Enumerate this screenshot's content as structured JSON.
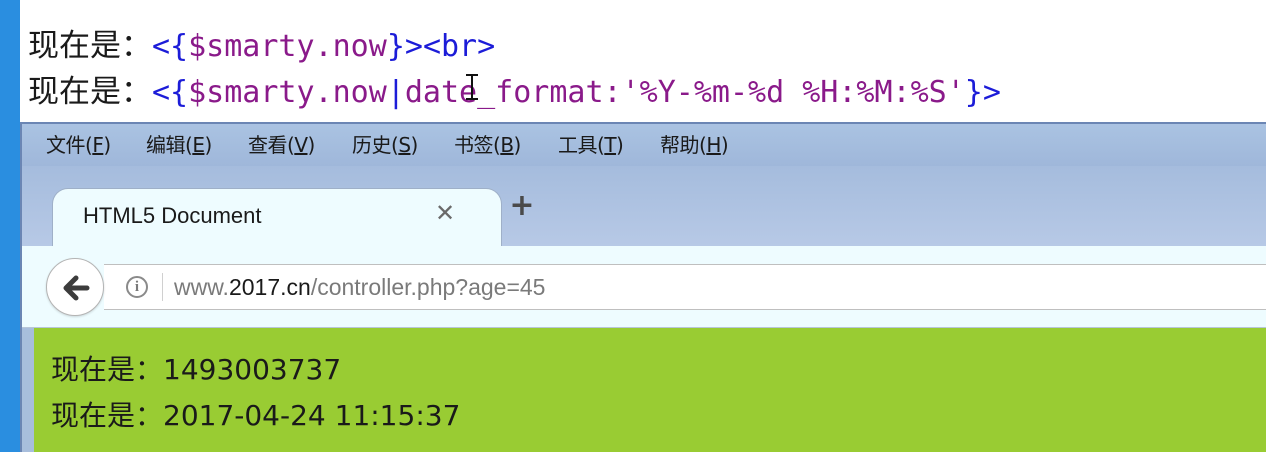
{
  "editor": {
    "line1": {
      "label": "现在是：",
      "open": "<{",
      "var": "$smarty.now",
      "close": "}>",
      "tag": "<br>"
    },
    "line2": {
      "label": "现在是：",
      "open": "<{",
      "var": "$smarty.now",
      "pipe": "|",
      "modifier": "date_format:",
      "arg": "'%Y-%m-%d %H:%M:%S'",
      "close": "}>"
    }
  },
  "browser": {
    "menu": [
      {
        "label": "文件(",
        "key": "F",
        "end": ")"
      },
      {
        "label": "编辑(",
        "key": "E",
        "end": ")"
      },
      {
        "label": "查看(",
        "key": "V",
        "end": ")"
      },
      {
        "label": "历史(",
        "key": "S",
        "end": ")"
      },
      {
        "label": "书签(",
        "key": "B",
        "end": ")"
      },
      {
        "label": "工具(",
        "key": "T",
        "end": ")"
      },
      {
        "label": "帮助(",
        "key": "H",
        "end": ")"
      }
    ],
    "tab": {
      "title": "HTML5 Document",
      "close_glyph": "✕",
      "new_tab_glyph": "+"
    },
    "address": {
      "prefix": "www.",
      "host": "2017.cn",
      "path": "/controller.php?age=45"
    },
    "page": {
      "line1": "现在是：1493003737",
      "line2": "现在是：2017-04-24 11:15:37"
    }
  },
  "colors": {
    "page_background": "#99cc33",
    "chrome_blue": "#a8bedc",
    "tag_blue": "#1c1cd8",
    "var_purple": "#8a1a8a"
  }
}
